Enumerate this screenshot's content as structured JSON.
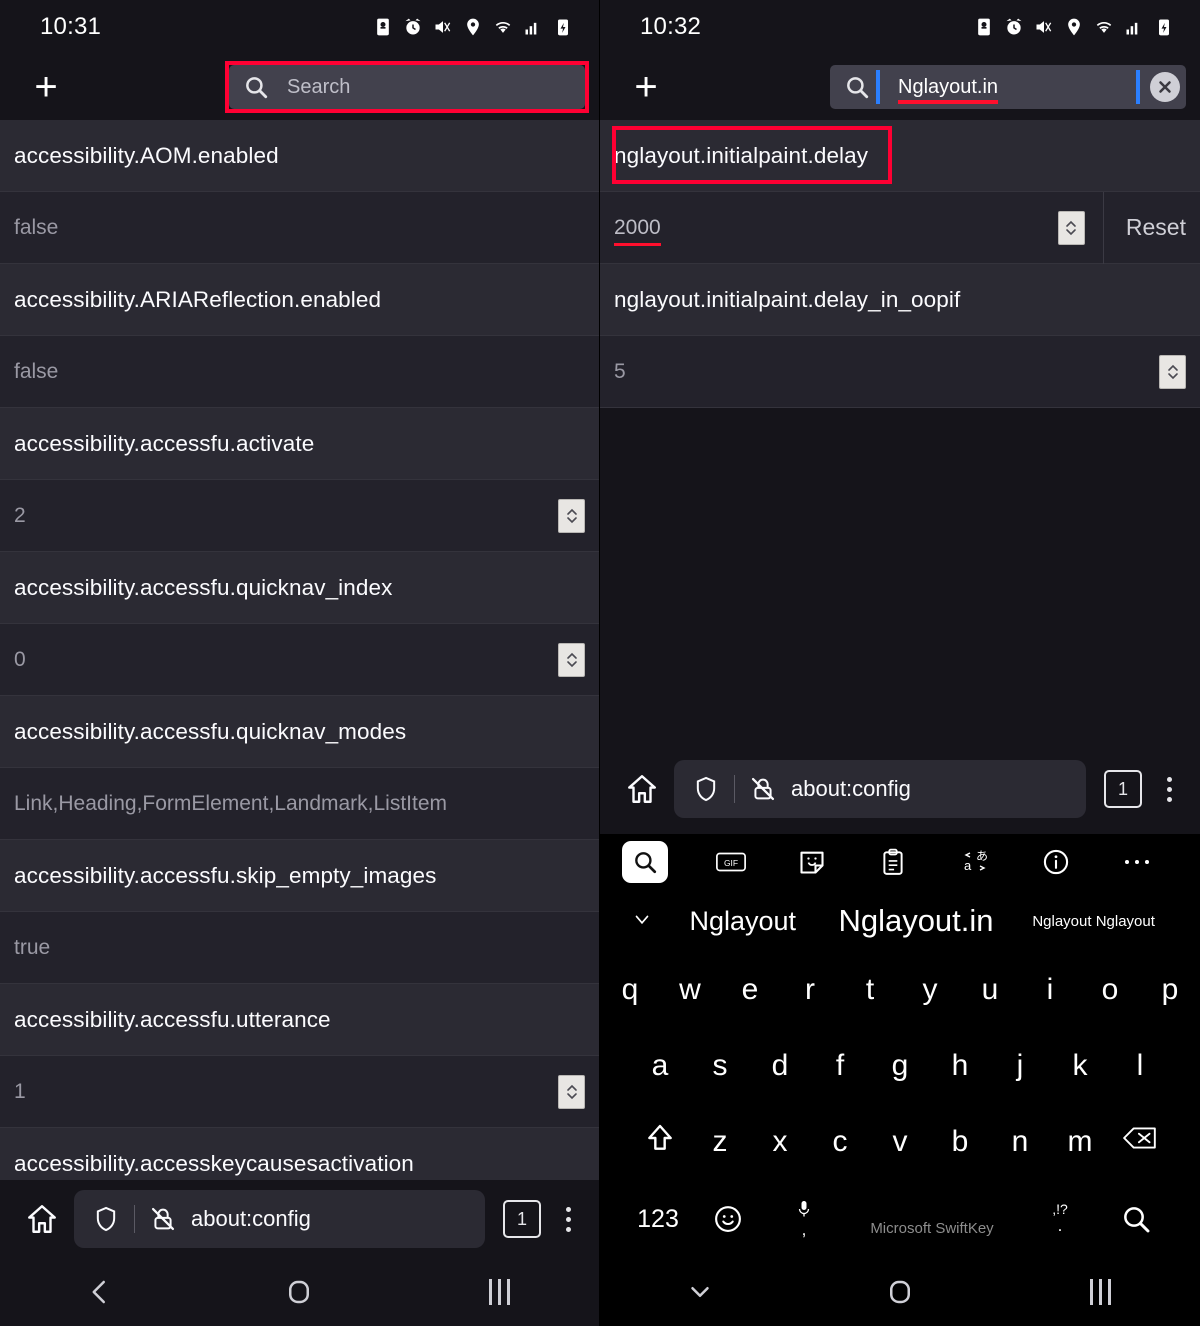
{
  "left": {
    "status": {
      "time": "10:31",
      "icons": [
        "data-saver-icon",
        "alarm-icon",
        "mute-vibrate-icon",
        "location-icon",
        "wifi-icon",
        "signal-icon",
        "battery-charging-icon"
      ]
    },
    "header": {
      "new_tab_label": "+",
      "search_placeholder": "Search",
      "search_value": "",
      "search_icon": "search-icon"
    },
    "prefs": [
      {
        "name": "accessibility.AOM.enabled",
        "value": "false",
        "spinner": false
      },
      {
        "name": "accessibility.ARIAReflection.enabled",
        "value": "false",
        "spinner": false
      },
      {
        "name": "accessibility.accessfu.activate",
        "value": "2",
        "spinner": true
      },
      {
        "name": "accessibility.accessfu.quicknav_index",
        "value": "0",
        "spinner": true
      },
      {
        "name": "accessibility.accessfu.quicknav_modes",
        "value": "Link,Heading,FormElement,Landmark,ListItem",
        "spinner": false
      },
      {
        "name": "accessibility.accessfu.skip_empty_images",
        "value": "true",
        "spinner": false
      },
      {
        "name": "accessibility.accessfu.utterance",
        "value": "1",
        "spinner": true
      },
      {
        "name": "accessibility.accesskeycausesactivation",
        "value": "",
        "spinner": false
      }
    ],
    "toolbar": {
      "home_icon": "home-icon",
      "shield_icon": "shield-icon",
      "lock_crossed_icon": "lock-crossed-icon",
      "url": "about:config",
      "tab_count": "1",
      "menu_icon": "kebab-menu-icon"
    },
    "navbar": {
      "back_icon": "back-icon",
      "home_icon": "home-circle-icon",
      "recents_icon": "recents-icon"
    }
  },
  "right": {
    "status": {
      "time": "10:32",
      "icons": [
        "data-saver-icon",
        "alarm-icon",
        "mute-vibrate-icon",
        "location-icon",
        "wifi-icon",
        "signal-icon",
        "battery-charging-icon"
      ]
    },
    "header": {
      "new_tab_label": "+",
      "search_value": "Nglayout.in",
      "search_icon": "search-icon",
      "clear_icon": "clear-x-icon"
    },
    "prefs": [
      {
        "name": "nglayout.initialpaint.delay",
        "value": "2000",
        "spinner": true,
        "reset": "Reset",
        "modified": true
      },
      {
        "name": "nglayout.initialpaint.delay_in_oopif",
        "value": "5",
        "spinner": true,
        "modified": false
      }
    ],
    "toolbar": {
      "home_icon": "home-icon",
      "shield_icon": "shield-icon",
      "lock_crossed_icon": "lock-crossed-icon",
      "url": "about:config",
      "tab_count": "1",
      "menu_icon": "kebab-menu-icon"
    },
    "keyboard": {
      "toolbar_icons": [
        "search-icon",
        "gif-icon",
        "sticker-icon",
        "clipboard-icon",
        "translate-icon",
        "info-icon",
        "more-icon"
      ],
      "close_suggestions_icon": "close-x-icon",
      "suggestions": [
        "Nglayout",
        "Nglayout.in",
        "Nglayout Nglayout"
      ],
      "row1": [
        "q",
        "w",
        "e",
        "r",
        "t",
        "y",
        "u",
        "i",
        "o",
        "p"
      ],
      "row2": [
        "a",
        "s",
        "d",
        "f",
        "g",
        "h",
        "j",
        "k",
        "l"
      ],
      "row3": [
        "z",
        "x",
        "c",
        "v",
        "b",
        "n",
        "m"
      ],
      "shift_icon": "shift-icon",
      "backspace_icon": "backspace-icon",
      "numbers_label": "123",
      "emoji_icon": "emoji-icon",
      "comma_key": {
        "top_icon": "microphone-icon",
        "bottom": ","
      },
      "space_label": "Microsoft SwiftKey",
      "period_key": {
        "top": ",!?",
        "bottom": "."
      },
      "enter_icon": "search-icon"
    },
    "navbar": {
      "dismiss_icon": "chevron-down-icon",
      "home_icon": "home-circle-icon",
      "recents_icon": "recents-icon"
    }
  },
  "annotations": {
    "left_search_box": "red-highlight-box",
    "right_pref_box": "red-highlight-box"
  },
  "colors": {
    "accent_red": "#ff0033",
    "bg": "#15141a",
    "row_name_bg": "#2b2a33",
    "row_value_bg": "#23222b",
    "caret_blue": "#2b7fff"
  }
}
